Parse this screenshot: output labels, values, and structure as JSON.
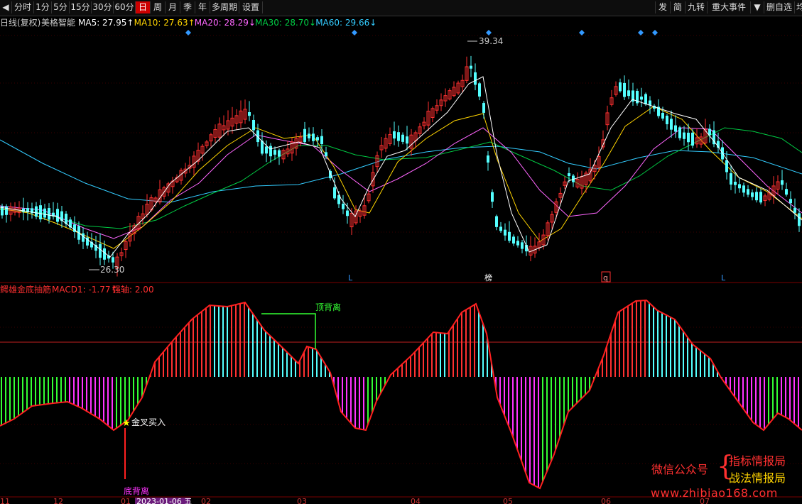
{
  "toolbar": {
    "arrow_left": "◀",
    "periods": [
      "分时",
      "1分",
      "5分",
      "15分",
      "30分",
      "60分",
      "日",
      "周",
      "月",
      "季",
      "年",
      "多周期",
      "设置"
    ],
    "active_period": "日",
    "right_buttons": [
      "发",
      "简",
      "九转",
      "重大事件",
      "▼",
      "删自选",
      "均线"
    ]
  },
  "chart_data": [
    {
      "type": "candlestick",
      "header": {
        "prefix": "日线(复权)",
        "name": "美格智能",
        "ma": [
          {
            "label": "MA5",
            "value": "27.95",
            "arrow": "↑",
            "color": "#ffffff"
          },
          {
            "label": "MA10",
            "value": "27.63",
            "arrow": "↑",
            "color": "#ffd400"
          },
          {
            "label": "MA20",
            "value": "28.29",
            "arrow": "↓",
            "color": "#ff66ff"
          },
          {
            "label": "MA30",
            "value": "28.70",
            "arrow": "↓",
            "color": "#00cc44"
          },
          {
            "label": "MA60",
            "value": "29.66",
            "arrow": "↓",
            "color": "#33ccff"
          }
        ]
      },
      "high_label": "39.34",
      "low_label": "26.30",
      "marker_labels": [
        "L",
        "榜",
        "q",
        "L"
      ],
      "colors": {
        "up": "#ff3030",
        "down": "#54ffff",
        "ma5": "#ffffff",
        "ma10": "#ffd400",
        "ma20": "#ff66ff",
        "ma30": "#00cc44",
        "ma60": "#33ccff"
      }
    },
    {
      "type": "bar",
      "header": {
        "title": "鳄雄金底抽筋",
        "macd_label": "MACD1",
        "macd_value": "-1.77",
        "macd_arrow": "↑",
        "axis_label": "强轴",
        "axis_value": "2.00"
      },
      "annotations": {
        "top_divergence": "顶背离",
        "golden_cross": "金叉买入",
        "bottom_divergence": "底背离"
      }
    }
  ],
  "date_axis": [
    "11",
    "12",
    "01",
    "2023-01-06 五",
    "02",
    "03",
    "04",
    "05",
    "06",
    "07"
  ],
  "watermark": {
    "wechat": "微信公众号",
    "line1": "指标情报局",
    "line2": "战法情报局",
    "url": "www.zhibiao168.com"
  }
}
